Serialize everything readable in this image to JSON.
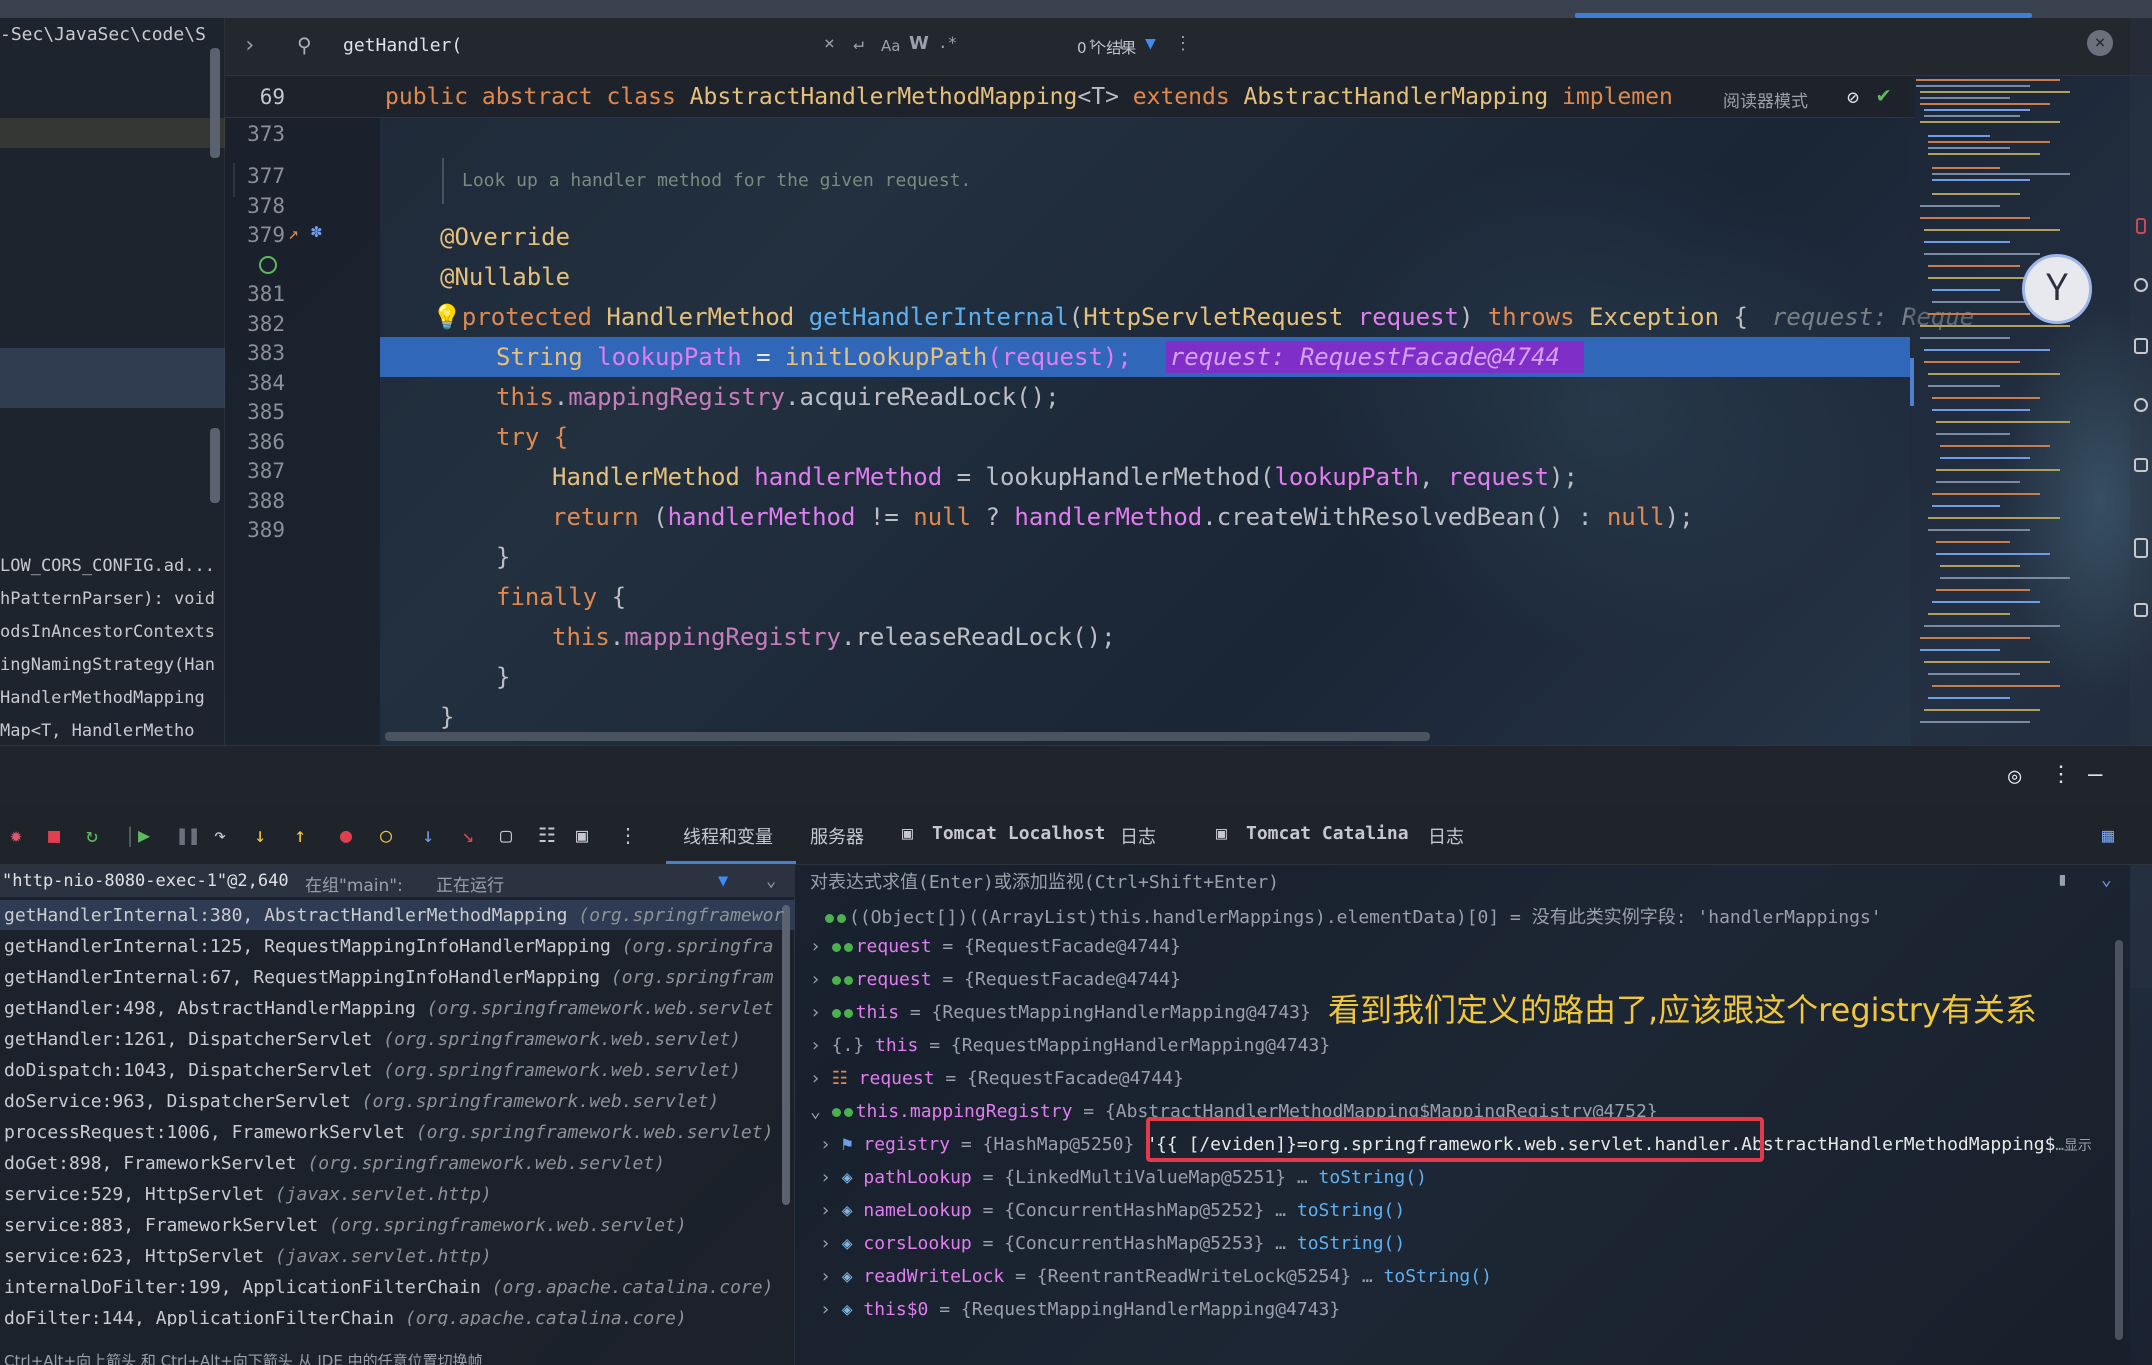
{
  "tree": {
    "path": "-Sec\\JavaSec\\code\\S",
    "items": [
      "LOW_CORS_CONFIG.ad...",
      "hPatternParser): void",
      "odsInAncestorContexts",
      "ingNamingStrategy(Han",
      " HandlerMethodMapping",
      " Map<T, HandlerMetho"
    ]
  },
  "search": {
    "query": "getHandler(",
    "opts": [
      "Aa",
      "W",
      ".*"
    ],
    "result": "0 个结果"
  },
  "sticky": {
    "line": "69",
    "kw1": "public abstract class ",
    "cls": "AbstractHandlerMethodMapping",
    "gen": "<T>",
    "kw2": " extends ",
    "parent": "AbstractHandlerMapping",
    "kw3": " implemen",
    "reader": "阅读器模式"
  },
  "gutter": [
    "373",
    "377",
    "378",
    "379",
    "381",
    "382",
    "383",
    "384",
    "385",
    "386",
    "387",
    "388",
    "389"
  ],
  "doc": "Look up a handler method for the given request.",
  "code": {
    "l377": "@Override",
    "l378": "@Nullable",
    "l379_a": "protected ",
    "l379_b": "HandlerMethod ",
    "l379_c": "getHandlerInternal",
    "l379_d": "(",
    "l379_e": "HttpServletRequest ",
    "l379_f": "request",
    "l379_g": ") ",
    "l379_h": "throws ",
    "l379_i": "Exception",
    "l379_j": " {",
    "l379_hint": "request: Reque",
    "l380_a": "String ",
    "l380_b": "lookupPath",
    "l380_c": " = ",
    "l380_d": "initLookupPath",
    "l380_e": "(request);",
    "l380_hint": "request: RequestFacade@4744",
    "l381_a": "this",
    "l381_b": ".",
    "l381_c": "mappingRegistry",
    "l381_d": ".acquireReadLock();",
    "l382": "try {",
    "l383_a": "HandlerMethod ",
    "l383_b": "handlerMethod",
    "l383_c": " = lookupHandlerMethod(",
    "l383_d": "lookupPath",
    "l383_e": ", ",
    "l383_f": "request",
    "l383_g": ");",
    "l384_a": "return ",
    "l384_b": "(",
    "l384_c": "handlerMethod",
    "l384_d": " != ",
    "l384_e": "null",
    "l384_f": " ? ",
    "l384_g": "handlerMethod",
    "l384_h": ".createWithResolvedBean() : ",
    "l384_i": "null",
    "l384_j": ");",
    "l385": "}",
    "l386_a": "finally",
    "l386_b": " {",
    "l387_a": "this",
    "l387_b": ".",
    "l387_c": "mappingRegistry",
    "l387_d": ".releaseReadLock();",
    "l388": "}",
    "l389": "}"
  },
  "debug": {
    "tabs": [
      "线程和变量",
      "服务器",
      "Tomcat Localhost",
      "日志",
      "Tomcat Catalina",
      "日志"
    ],
    "thread": {
      "name": "\"http-nio-8080-exec-1\"@2,640",
      "group": " 在组\"main\": ",
      "state": "正在运行"
    },
    "frames": [
      {
        "m": "getHandlerInternal:380, AbstractHandlerMethodMapping ",
        "p": "(org.springframework"
      },
      {
        "m": "getHandlerInternal:125, RequestMappingInfoHandlerMapping ",
        "p": "(org.springfra"
      },
      {
        "m": "getHandlerInternal:67, RequestMappingInfoHandlerMapping ",
        "p": "(org.springfram"
      },
      {
        "m": "getHandler:498, AbstractHandlerMapping ",
        "p": "(org.springframework.web.servlet"
      },
      {
        "m": "getHandler:1261, DispatcherServlet ",
        "p": "(org.springframework.web.servlet)"
      },
      {
        "m": "doDispatch:1043, DispatcherServlet ",
        "p": "(org.springframework.web.servlet)"
      },
      {
        "m": "doService:963, DispatcherServlet ",
        "p": "(org.springframework.web.servlet)"
      },
      {
        "m": "processRequest:1006, FrameworkServlet ",
        "p": "(org.springframework.web.servlet)"
      },
      {
        "m": "doGet:898, FrameworkServlet ",
        "p": "(org.springframework.web.servlet)"
      },
      {
        "m": "service:529, HttpServlet ",
        "p": "(javax.servlet.http)"
      },
      {
        "m": "service:883, FrameworkServlet ",
        "p": "(org.springframework.web.servlet)"
      },
      {
        "m": "service:623, HttpServlet ",
        "p": "(javax.servlet.http)"
      },
      {
        "m": "internalDoFilter:199, ApplicationFilterChain ",
        "p": "(org.apache.catalina.core)"
      },
      {
        "m": "doFilter:144, ApplicationFilterChain ",
        "p": "(org.apache.catalina.core)"
      }
    ],
    "tip": "Ctrl+Alt+向上箭头 和 Ctrl+Alt+向下箭头 从 IDE 中的任意位置切换帧",
    "prompt": "对表达式求值(Enter)或添加监视(Ctrl+Shift+Enter)",
    "vars": [
      {
        "n": "((Object[])((ArrayList)this.handlerMappings).elementData)[0]",
        "v": " = 没有此类实例字段: 'handlerMappings'"
      },
      {
        "n": "request",
        "v": " = {RequestFacade@4744}"
      },
      {
        "n": "request",
        "v": " = {RequestFacade@4744}"
      },
      {
        "n": "this",
        "v": " = {RequestMappingHandlerMapping@4743}"
      },
      {
        "n": "this",
        "v": " = {RequestMappingHandlerMapping@4743}"
      },
      {
        "n": "request",
        "v": " = {RequestFacade@4744}"
      },
      {
        "n": "this.mappingRegistry",
        "v": " = {AbstractHandlerMethodMapping$MappingRegistry@4752}"
      },
      {
        "n": "registry",
        "v": " = {HashMap@5250} ",
        "s": "\"{{ [/eviden]}=org.springframework.web.servlet.handler.AbstractHandlerMethodMapping$",
        "x": "…显示"
      },
      {
        "n": "pathLookup",
        "v": " = {LinkedMultiValueMap@5251} … ",
        "l": "toString()"
      },
      {
        "n": "nameLookup",
        "v": " = {ConcurrentHashMap@5252} … ",
        "l": "toString()"
      },
      {
        "n": "corsLookup",
        "v": " = {ConcurrentHashMap@5253} … ",
        "l": "toString()"
      },
      {
        "n": "readWriteLock",
        "v": " = {ReentrantReadWriteLock@5254} … ",
        "l": "toString()"
      },
      {
        "n": "this$0",
        "v": " = {RequestMappingHandlerMapping@4743}"
      }
    ],
    "annotation": "看到我们定义的路由了,应该跟这个registry有关系"
  }
}
